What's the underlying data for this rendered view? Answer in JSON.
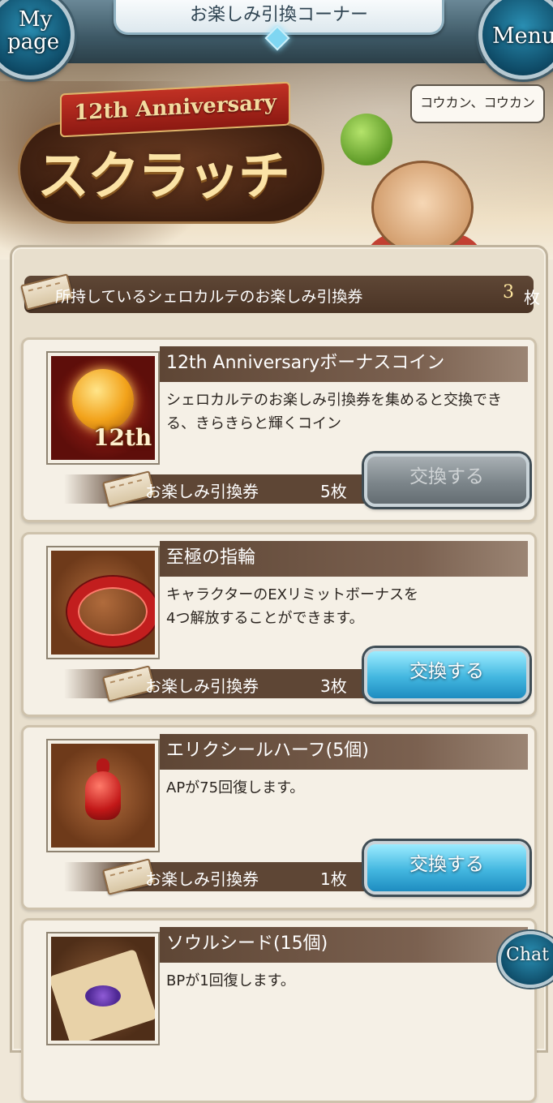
{
  "header": {
    "title": "お楽しみ引換コーナー",
    "mypage_line1": "My",
    "mypage_line2": "page",
    "menu_label": "Menu"
  },
  "banner": {
    "anniversary_label": "12th Anniversary",
    "logo_text": "スクラッチ",
    "speech_text": "コウカン、コウカン"
  },
  "tickets": {
    "label": "所持しているシェロカルテのお楽しみ引換券",
    "count": "3",
    "unit": "枚"
  },
  "items": [
    {
      "name": "12th Anniversaryボーナスコイン",
      "description": "シェロカルテのお楽しみ引換券を集めると交換できる、きらきらと輝くコイン",
      "icon": "bonus-coin-icon",
      "icon_label": "12th",
      "cost_label": "お楽しみ引換券",
      "cost_count": "5枚",
      "button_label": "交換する",
      "enabled": false
    },
    {
      "name": "至極の指輪",
      "description_line1": "キャラクターのEXリミットボーナスを",
      "description_line2": "4つ解放することができます。",
      "icon": "ring-icon",
      "cost_label": "お楽しみ引換券",
      "cost_count": "3枚",
      "button_label": "交換する",
      "enabled": true
    },
    {
      "name": "エリクシールハーフ(5個)",
      "description": "APが75回復します。",
      "icon": "potion-icon",
      "cost_label": "お楽しみ引換券",
      "cost_count": "1枚",
      "button_label": "交換する",
      "enabled": true
    },
    {
      "name": "ソウルシード(15個)",
      "description": "BPが1回復します。",
      "icon": "soul-seed-icon"
    }
  ],
  "chat": {
    "label": "Chat"
  },
  "colors": {
    "active_button": "#43b7e0",
    "disabled_button": "#7d868b",
    "bar_brown": "#5e4635"
  }
}
